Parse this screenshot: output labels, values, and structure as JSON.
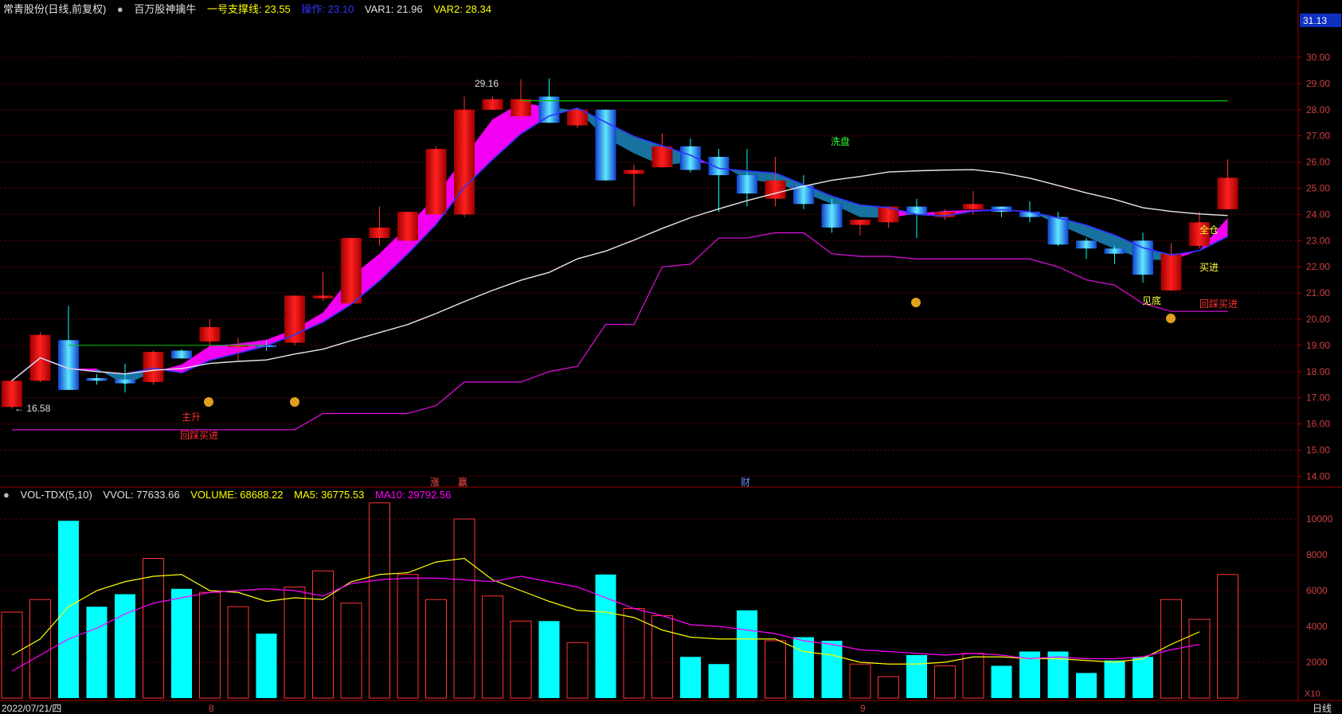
{
  "header": {
    "stock_name": "常青股份(日线,前复权)",
    "indicator_name": "百万股神擒牛",
    "support_label": "一号支撑线: 23.55",
    "op_label": "操作: 23.10",
    "var1_label": "VAR1: 21.96",
    "var2_label": "VAR2: 28.34"
  },
  "vol_header": {
    "name": "VOL-TDX(5,10)",
    "vvol": "VVOL: 77633.66",
    "volume": "VOLUME: 68688.22",
    "ma5": "MA5: 36775.53",
    "ma10": "MA10: 29792.56"
  },
  "price_axis": {
    "current": "31.13",
    "ticks": [
      "30.00",
      "29.00",
      "28.00",
      "27.00",
      "26.00",
      "25.00",
      "24.00",
      "23.00",
      "22.00",
      "21.00",
      "20.00",
      "19.00",
      "18.00",
      "17.00",
      "16.00",
      "15.00",
      "14.00"
    ]
  },
  "vol_axis": {
    "ticks": [
      "10000",
      "8000",
      "6000",
      "4000",
      "2000"
    ],
    "unit": "X10"
  },
  "bottom": {
    "date": "2022/07/21/四",
    "month8": "8",
    "month9": "9",
    "period": "日线"
  },
  "annotations": {
    "high": "29.16",
    "low": "16.58",
    "wash": "洗盘",
    "main_up": "主升",
    "pullback_buy_1": "回踩买进",
    "full_position": "全仓",
    "buy_in": "买进",
    "bottom_seen": "见底",
    "pullback_buy_2": "回踩买进",
    "event_zhang": "涨",
    "event_ying": "赢",
    "event_cai": "财"
  },
  "colors": {
    "up": "#ff3333",
    "down": "#00ffff",
    "magenta": "#ff00ff",
    "yellow": "#ffff00",
    "accent_green": "#00c800"
  },
  "chart_data": {
    "type": "candlestick",
    "candles": [
      {
        "o": 16.65,
        "h": 17.7,
        "l": 16.58,
        "c": 17.65,
        "v": 4800
      },
      {
        "o": 17.65,
        "h": 19.5,
        "l": 17.6,
        "c": 19.4,
        "v": 5500
      },
      {
        "o": 19.2,
        "h": 20.5,
        "l": 17.7,
        "c": 17.3,
        "v": 9900
      },
      {
        "o": 17.75,
        "h": 17.9,
        "l": 17.5,
        "c": 17.65,
        "v": 5100
      },
      {
        "o": 17.7,
        "h": 18.3,
        "l": 17.2,
        "c": 17.55,
        "v": 5800
      },
      {
        "o": 17.6,
        "h": 18.8,
        "l": 17.5,
        "c": 18.75,
        "v": 7800
      },
      {
        "o": 18.8,
        "h": 18.85,
        "l": 18.5,
        "c": 18.5,
        "v": 6100
      },
      {
        "o": 19.15,
        "h": 20.0,
        "l": 19.0,
        "c": 19.7,
        "v": 5900
      },
      {
        "o": 19.0,
        "h": 19.3,
        "l": 18.4,
        "c": 19.0,
        "v": 5100
      },
      {
        "o": 19.0,
        "h": 19.2,
        "l": 18.8,
        "c": 18.95,
        "v": 3600
      },
      {
        "o": 19.1,
        "h": 20.0,
        "l": 19.0,
        "c": 20.9,
        "v": 6200
      },
      {
        "o": 20.8,
        "h": 21.8,
        "l": 20.7,
        "c": 20.9,
        "v": 7100
      },
      {
        "o": 20.6,
        "h": 23.1,
        "l": 20.6,
        "c": 23.1,
        "v": 5300
      },
      {
        "o": 23.1,
        "h": 24.3,
        "l": 22.8,
        "c": 23.5,
        "v": 10900
      },
      {
        "o": 23.0,
        "h": 24.0,
        "l": 22.9,
        "c": 24.1,
        "v": 6900
      },
      {
        "o": 24.0,
        "h": 26.6,
        "l": 24.0,
        "c": 26.5,
        "v": 5500
      },
      {
        "o": 24.0,
        "h": 28.5,
        "l": 23.9,
        "c": 28.0,
        "v": 10000
      },
      {
        "o": 28.0,
        "h": 28.5,
        "l": 28.0,
        "c": 28.4,
        "v": 5700
      },
      {
        "o": 27.75,
        "h": 29.16,
        "l": 27.6,
        "c": 28.4,
        "v": 4300
      },
      {
        "o": 28.5,
        "h": 29.2,
        "l": 27.5,
        "c": 27.5,
        "v": 4300
      },
      {
        "o": 27.4,
        "h": 28.0,
        "l": 27.3,
        "c": 28.0,
        "v": 3100
      },
      {
        "o": 28.0,
        "h": 28.0,
        "l": 25.3,
        "c": 25.3,
        "v": 6900
      },
      {
        "o": 25.55,
        "h": 25.9,
        "l": 24.3,
        "c": 25.7,
        "v": 5000
      },
      {
        "o": 25.8,
        "h": 27.1,
        "l": 25.8,
        "c": 26.6,
        "v": 4600
      },
      {
        "o": 26.6,
        "h": 26.9,
        "l": 25.6,
        "c": 25.7,
        "v": 2300
      },
      {
        "o": 26.2,
        "h": 26.5,
        "l": 24.1,
        "c": 25.5,
        "v": 1900
      },
      {
        "o": 25.5,
        "h": 26.5,
        "l": 24.3,
        "c": 24.8,
        "v": 4900
      },
      {
        "o": 24.6,
        "h": 26.2,
        "l": 24.3,
        "c": 25.3,
        "v": 3200
      },
      {
        "o": 25.1,
        "h": 25.5,
        "l": 24.2,
        "c": 24.4,
        "v": 3400
      },
      {
        "o": 24.4,
        "h": 24.6,
        "l": 23.3,
        "c": 23.5,
        "v": 3200
      },
      {
        "o": 23.6,
        "h": 23.7,
        "l": 23.2,
        "c": 23.8,
        "v": 1900
      },
      {
        "o": 23.7,
        "h": 24.3,
        "l": 23.5,
        "c": 24.3,
        "v": 1200
      },
      {
        "o": 24.3,
        "h": 24.6,
        "l": 23.1,
        "c": 24.0,
        "v": 2400
      },
      {
        "o": 23.9,
        "h": 24.2,
        "l": 23.8,
        "c": 24.1,
        "v": 1800
      },
      {
        "o": 24.2,
        "h": 24.9,
        "l": 24.0,
        "c": 24.4,
        "v": 2500
      },
      {
        "o": 24.3,
        "h": 24.3,
        "l": 23.9,
        "c": 24.1,
        "v": 1800
      },
      {
        "o": 24.1,
        "h": 24.5,
        "l": 23.7,
        "c": 23.9,
        "v": 2600
      },
      {
        "o": 23.9,
        "h": 24.1,
        "l": 22.8,
        "c": 22.85,
        "v": 2600
      },
      {
        "o": 23.0,
        "h": 23.1,
        "l": 22.3,
        "c": 22.7,
        "v": 1400
      },
      {
        "o": 22.7,
        "h": 22.8,
        "l": 22.1,
        "c": 22.5,
        "v": 2100
      },
      {
        "o": 23.0,
        "h": 23.3,
        "l": 21.4,
        "c": 21.7,
        "v": 2300
      },
      {
        "o": 21.1,
        "h": 22.9,
        "l": 21.1,
        "c": 22.5,
        "v": 5500
      },
      {
        "o": 22.8,
        "h": 24.1,
        "l": 22.7,
        "c": 23.7,
        "v": 4400
      },
      {
        "o": 24.2,
        "h": 26.1,
        "l": 24.2,
        "c": 25.4,
        "v": 6900
      }
    ],
    "vol_ma5": [
      2400,
      3300,
      5100,
      6000,
      6500,
      6800,
      6900,
      6000,
      5900,
      5400,
      5600,
      5500,
      6500,
      6900,
      7000,
      7600,
      7800,
      6600,
      6000,
      5400,
      4900,
      4800,
      4500,
      3800,
      3400,
      3300,
      3300,
      3300,
      2600,
      2400,
      2000,
      1900,
      1900,
      2000,
      2300,
      2300,
      2200,
      2200,
      2100,
      2000,
      2200,
      3000,
      3700
    ],
    "vol_ma10": [
      1500,
      2400,
      3300,
      3900,
      4700,
      5300,
      5600,
      5900,
      6000,
      6100,
      6000,
      5700,
      6400,
      6600,
      6700,
      6700,
      6600,
      6500,
      6800,
      6500,
      6200,
      5600,
      5000,
      4600,
      4100,
      4000,
      3800,
      3600,
      3200,
      3000,
      2700,
      2600,
      2500,
      2400,
      2500,
      2400,
      2200,
      2300,
      2200,
      2200,
      2300,
      2700,
      3000
    ]
  }
}
